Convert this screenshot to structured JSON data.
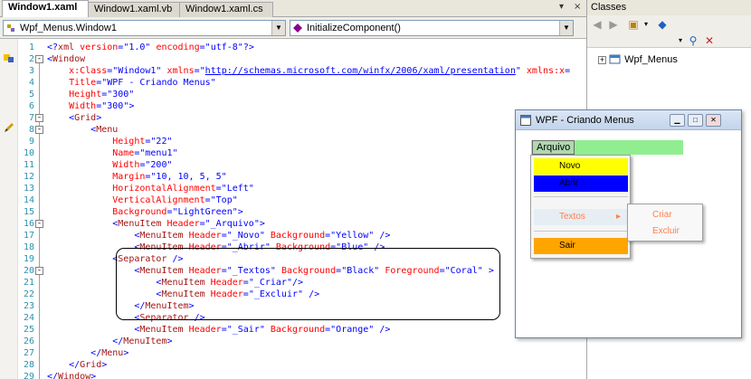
{
  "tabs": [
    {
      "label": "Window1.xaml"
    },
    {
      "label": "Window1.xaml.vb"
    },
    {
      "label": "Window1.xaml.cs"
    }
  ],
  "tab_controls": {
    "dropdown": "▾",
    "close": "×"
  },
  "combos": {
    "left": "Wpf_Menus.Window1",
    "right": "InitializeComponent()"
  },
  "code_lines": [
    {
      "n": "1",
      "code": "<?xml version=\"1.0\" encoding=\"utf-8\"?>"
    },
    {
      "n": "2",
      "code": "<Window"
    },
    {
      "n": "3",
      "code": "    x:Class=\"Window1\" xmlns=\"http://schemas.microsoft.com/winfx/2006/xaml/presentation\" xmlns:x="
    },
    {
      "n": "4",
      "code": "    Title=\"WPF - Criando Menus\""
    },
    {
      "n": "5",
      "code": "    Height=\"300\""
    },
    {
      "n": "6",
      "code": "    Width=\"300\">"
    },
    {
      "n": "7",
      "code": "    <Grid>"
    },
    {
      "n": "8",
      "code": "        <Menu"
    },
    {
      "n": "9",
      "code": "            Height=\"22\""
    },
    {
      "n": "10",
      "code": "            Name=\"menu1\""
    },
    {
      "n": "11",
      "code": "            Width=\"200\""
    },
    {
      "n": "12",
      "code": "            Margin=\"10, 10, 5, 5\""
    },
    {
      "n": "13",
      "code": "            HorizontalAlignment=\"Left\""
    },
    {
      "n": "14",
      "code": "            VerticalAlignment=\"Top\""
    },
    {
      "n": "15",
      "code": "            Background=\"LightGreen\">"
    },
    {
      "n": "16",
      "code": "            <MenuItem Header=\"_Arquivo\">"
    },
    {
      "n": "17",
      "code": "                <MenuItem Header=\"_Novo\" Background=\"Yellow\" />"
    },
    {
      "n": "18",
      "code": "                <MenuItem Header=\"_Abrir\" Background=\"Blue\" />"
    },
    {
      "n": "19",
      "code": "            <Separator />"
    },
    {
      "n": "20",
      "code": "                <MenuItem Header=\"_Textos\" Background=\"Black\" Foreground=\"Coral\" >"
    },
    {
      "n": "21",
      "code": "                    <MenuItem Header=\"_Criar\"/>"
    },
    {
      "n": "22",
      "code": "                    <MenuItem Header=\"_Excluir\" />"
    },
    {
      "n": "23",
      "code": "                </MenuItem>"
    },
    {
      "n": "24",
      "code": "                <Separator />"
    },
    {
      "n": "25",
      "code": "                <MenuItem Header=\"_Sair\" Background=\"Orange\" />"
    },
    {
      "n": "26",
      "code": "            </MenuItem>"
    },
    {
      "n": "27",
      "code": "        </Menu>"
    },
    {
      "n": "28",
      "code": "    </Grid>"
    },
    {
      "n": "29",
      "code": "</Window>"
    }
  ],
  "classes_panel": {
    "title": "Classes",
    "tree_item": "Wpf_Menus",
    "expander": "+"
  },
  "preview_window": {
    "title": "WPF - Criando Menus",
    "menu_header": "Arquivo",
    "items": {
      "novo": "Novo",
      "abrir": "Abrir",
      "textos": "Textos",
      "sair": "Sair"
    },
    "submenu_arrow": "▸",
    "submenu": {
      "criar": "Criar",
      "excluir": "Excluir"
    },
    "colors": {
      "menubar": "#90ee90",
      "novo": "#ffff00",
      "abrir": "#0000ff",
      "sair": "#ffa500",
      "submenu_fg": "#ff7f50"
    }
  }
}
